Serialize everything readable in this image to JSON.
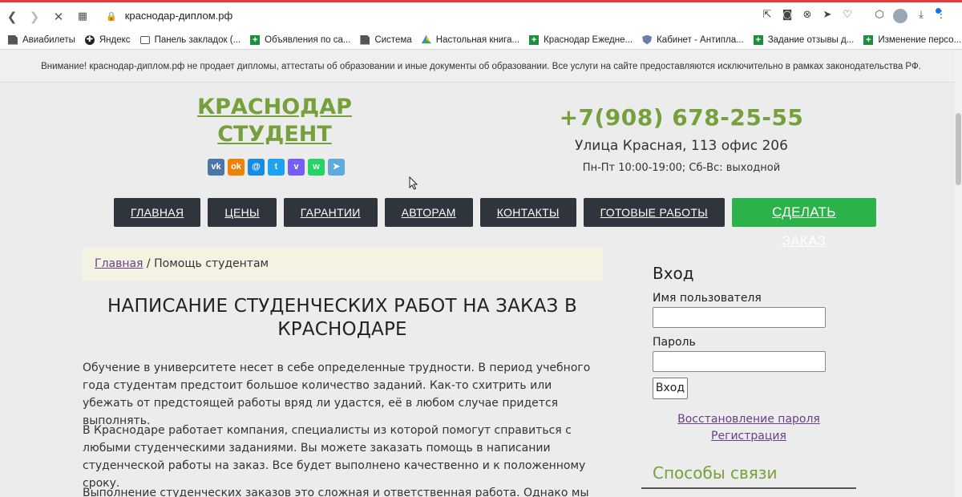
{
  "browser": {
    "url": "краснодар-диплом.рф",
    "bookmarks": [
      {
        "label": "Авиабилеты",
        "icon": "file"
      },
      {
        "label": "Яндекс",
        "icon": "circ"
      },
      {
        "label": "Панель закладок (...",
        "icon": "folder"
      },
      {
        "label": "Объявления по са...",
        "icon": "plus"
      },
      {
        "label": "Система",
        "icon": "file"
      },
      {
        "label": "Настольная книга...",
        "icon": "drive"
      },
      {
        "label": "Краснодар Ежедне...",
        "icon": "plus"
      },
      {
        "label": "Кабинет - Антипла...",
        "icon": "shield"
      },
      {
        "label": "Задание отзывы д...",
        "icon": "plus"
      },
      {
        "label": "Изменение персо...",
        "icon": "plus"
      }
    ]
  },
  "notice": "Внимание! краснодар-диплом.рф не продает дипломы, аттестаты об образовании и иные документы об образовании. Все услуги на сайте предоставляются исключительно в рамках законодательства РФ.",
  "header": {
    "logo_line1": "КРАСНОДАР",
    "logo_line2": "СТУДЕНТ",
    "phone": "+7(908) 678-25-55",
    "address": "Улица Красная, 113 офис 206",
    "hours": "Пн-Пт 10:00-19:00; Сб-Вс: выходной"
  },
  "socials": [
    {
      "name": "vk",
      "glyph": "vk",
      "color": "#4a76a8"
    },
    {
      "name": "ok",
      "glyph": "ok",
      "color": "#ee8208"
    },
    {
      "name": "moimir",
      "glyph": "@",
      "color": "#168de2"
    },
    {
      "name": "twitter",
      "glyph": "t",
      "color": "#1da1f2"
    },
    {
      "name": "viber",
      "glyph": "v",
      "color": "#7360f2"
    },
    {
      "name": "whatsapp",
      "glyph": "w",
      "color": "#25d366"
    },
    {
      "name": "telegram",
      "glyph": "➤",
      "color": "#5ea9dd"
    }
  ],
  "menu": [
    "ГЛАВНАЯ",
    "ЦЕНЫ",
    "ГАРАНТИИ",
    "АВТОРАМ",
    "КОНТАКТЫ",
    "ГОТОВЫЕ РАБОТЫ"
  ],
  "menu_cta": "СДЕЛАТЬ ЗАКАЗ",
  "breadcrumb": {
    "home": "Главная",
    "separator": " / ",
    "current": "Помощь студентам"
  },
  "page_title": "НАПИСАНИЕ СТУДЕНЧЕСКИХ РАБОТ НА ЗАКАЗ В КРАСНОДАРЕ",
  "paragraphs": [
    "Обучение в университете несет в себе определенные трудности. В период учебного года студентам предстоит большое количество заданий. Как-то схитрить или убежать от предстоящей работы вряд ли удастся, её в любом случае придется выполнять.",
    "В Краснодаре работает компания, специалисты из которой помогут справиться с любыми студенческими заданиями. Вы можете заказать помощь в написании студенческой работы на заказ. Все будет выполнено качественно и к положенному сроку.",
    "Выполнение студенческих заказов это сложная и ответственная работа. Однако мы уверены в"
  ],
  "login": {
    "title": "Вход",
    "username_label": "Имя пользователя",
    "password_label": "Пароль",
    "button": "Вход",
    "recover_link": "Восстановление пароля",
    "register_link": "Регистрация"
  },
  "contact_title": "Способы связи"
}
